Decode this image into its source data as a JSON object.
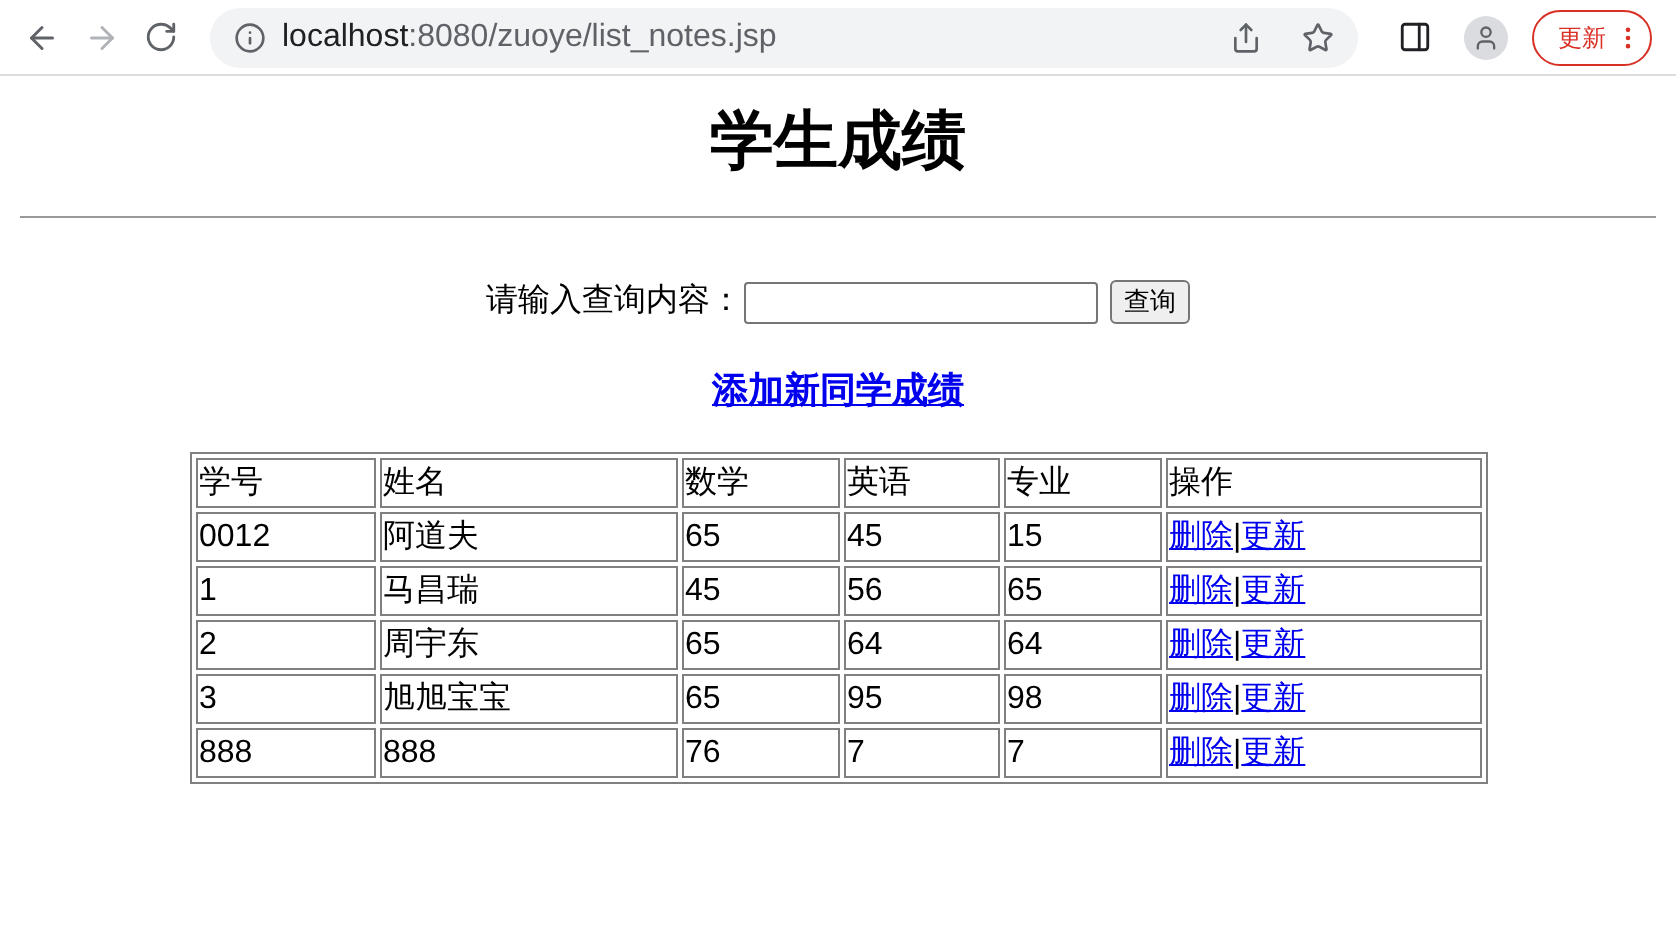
{
  "browser": {
    "url_host": "localhost",
    "url_rest": ":8080/zuoye/list_notes.jsp",
    "update_button": "更新"
  },
  "page": {
    "title": "学生成绩",
    "search_label": "请输入查询内容：",
    "search_button": "查询",
    "add_link": "添加新同学成绩"
  },
  "table": {
    "columns": [
      "学号",
      "姓名",
      "数学",
      "英语",
      "专业",
      "操作"
    ],
    "rows": [
      {
        "cells": [
          "0012",
          "阿道夫",
          "65",
          "45",
          "15"
        ],
        "actions": [
          "删除",
          "|",
          "更新"
        ]
      },
      {
        "cells": [
          "1",
          "马昌瑞",
          "45",
          "56",
          "65"
        ],
        "actions": [
          "删除",
          "|",
          "更新"
        ]
      },
      {
        "cells": [
          "2",
          "周宇东",
          "65",
          "64",
          "64"
        ],
        "actions": [
          "删除",
          "|",
          "更新"
        ]
      },
      {
        "cells": [
          "3",
          "旭旭宝宝",
          "65",
          "95",
          "98"
        ],
        "actions": [
          "删除",
          "|",
          "更新"
        ]
      },
      {
        "cells": [
          "888",
          "888",
          "76",
          "7",
          "7"
        ],
        "actions": [
          "删除",
          "|",
          "更新"
        ]
      }
    ]
  }
}
